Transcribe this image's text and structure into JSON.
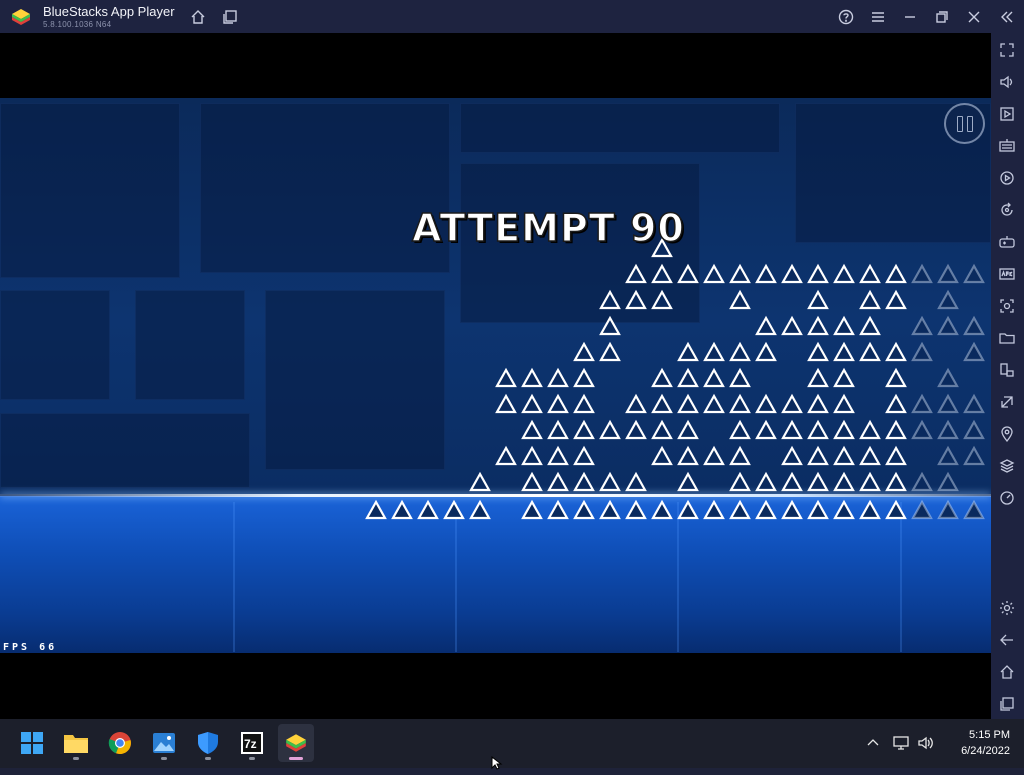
{
  "window": {
    "title": "BlueStacks App Player",
    "version": "5.8.100.1036 N64",
    "icons": [
      "help-icon",
      "menu-icon",
      "minimize-icon",
      "restore-icon",
      "close-icon",
      "collapse-sidebar-icon"
    ],
    "nav_icons": [
      "home-icon",
      "multi-instance-icon"
    ]
  },
  "game": {
    "attempt_text": "ATTEMPT 90",
    "fps_text": "FPS 66",
    "colors": {
      "background": "#0d3470",
      "ground": "#1a63d8",
      "spike_fill": "#ffffff"
    }
  },
  "sidebar": {
    "icons": [
      "fullscreen-icon",
      "volume-icon",
      "screen-record-icon",
      "keyboard-icon",
      "macro-icon",
      "rotate-icon",
      "gamepad-icon",
      "apk-icon",
      "screenshot-icon",
      "folder-icon",
      "resize-icon",
      "eco-mode-icon",
      "location-icon",
      "layers-icon",
      "speed-icon",
      "settings-icon",
      "back-icon",
      "home-icon",
      "recents-icon"
    ]
  },
  "taskbar": {
    "apps": [
      "windows-start-icon",
      "file-explorer-icon",
      "chrome-icon",
      "photos-icon",
      "defender-icon",
      "7zip-icon",
      "bluestacks-icon"
    ],
    "tray_time": "5:15 PM",
    "tray_date": "6/24/2022"
  }
}
